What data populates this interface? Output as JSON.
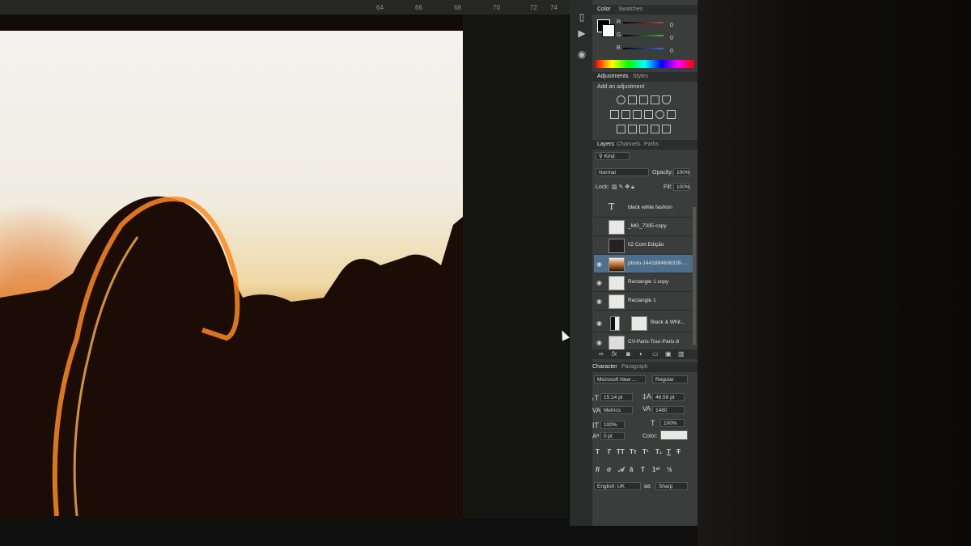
{
  "ruler": {
    "ticks": [
      "64",
      "66",
      "68",
      "70",
      "72",
      "74"
    ]
  },
  "color_panel": {
    "tabs": [
      "Color",
      "Swatches"
    ],
    "channels": [
      {
        "label": "R",
        "value": "0",
        "color": "#d23a3a"
      },
      {
        "label": "G",
        "value": "0",
        "color": "#3ab54a"
      },
      {
        "label": "B",
        "value": "0",
        "color": "#3a6ad2"
      }
    ]
  },
  "adjustments_panel": {
    "tabs": [
      "Adjustments",
      "Styles"
    ],
    "subtitle": "Add an adjustment"
  },
  "layers_panel": {
    "tabs": [
      "Layers",
      "Channels",
      "Paths"
    ],
    "kind_label": "Kind",
    "blend_mode": "Normal",
    "opacity_label": "Opacity:",
    "opacity_value": "100%",
    "lock_label": "Lock:",
    "fill_label": "Fill:",
    "fill_value": "100%",
    "layers": [
      {
        "name": "black white fashion",
        "type": "text",
        "visible": false,
        "selected": false
      },
      {
        "name": "_MG_7335 copy",
        "type": "image",
        "visible": false,
        "selected": false
      },
      {
        "name": "02 Com Edição",
        "type": "image",
        "visible": false,
        "selected": false
      },
      {
        "name": "photo-1441884606328-...",
        "type": "image",
        "visible": true,
        "selected": true
      },
      {
        "name": "Rectangle 1 copy",
        "type": "shape",
        "visible": true,
        "selected": false
      },
      {
        "name": "Rectangle 1",
        "type": "shape",
        "visible": true,
        "selected": false
      },
      {
        "name": "Black & Whit...",
        "type": "adjustment",
        "visible": true,
        "selected": false
      },
      {
        "name": "CV-Paris-Tour-Paris-8",
        "type": "image",
        "visible": true,
        "selected": false
      }
    ]
  },
  "character_panel": {
    "tabs": [
      "Character",
      "Paragraph"
    ],
    "font_family": "Microsoft New ...",
    "font_style": "Regular",
    "font_size": "15.14 pt",
    "leading": "46.59 pt",
    "kerning": "Metrics",
    "tracking": "1480",
    "vertical_scale": "100%",
    "horizontal_scale": "100%",
    "baseline_shift": "0 pt",
    "color_label": "Color:",
    "language": "English: UK",
    "anti_alias": "Sharp",
    "aa_label": "aa"
  },
  "colors": {
    "panel_bg": "#3a3d3b",
    "selected_layer": "#4d6f8c"
  }
}
